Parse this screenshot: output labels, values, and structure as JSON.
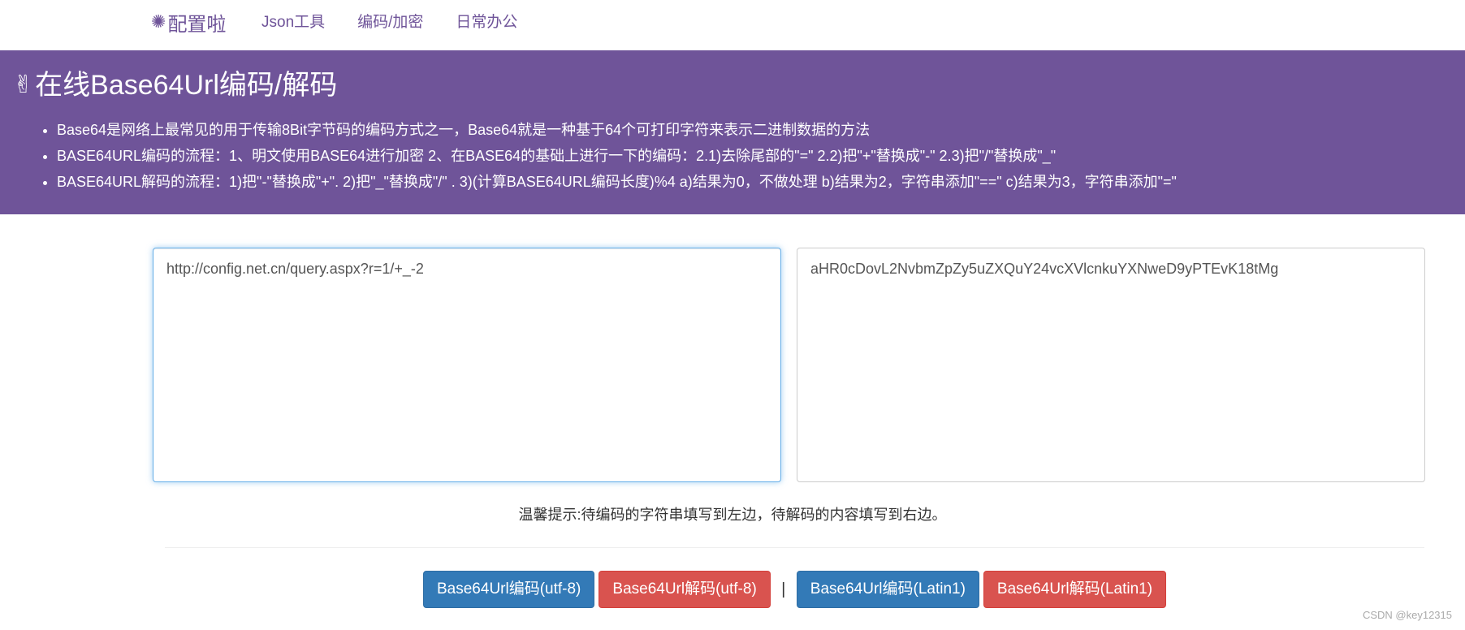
{
  "nav": {
    "brand": "配置啦",
    "brand_icon": "flower-icon",
    "links": [
      "Json工具",
      "编码/加密",
      "日常办公"
    ]
  },
  "hero": {
    "title": "在线Base64Url编码/解码",
    "title_icon": "victory-hand-icon",
    "bullets": [
      "Base64是网络上最常见的用于传输8Bit字节码的编码方式之一，Base64就是一种基于64个可打印字符来表示二进制数据的方法",
      "BASE64URL编码的流程：1、明文使用BASE64进行加密 2、在BASE64的基础上进行一下的编码：2.1)去除尾部的\"=\" 2.2)把\"+\"替换成\"-\" 2.3)把\"/\"替换成\"_\"",
      "BASE64URL解码的流程：1)把\"-\"替换成\"+\". 2)把\"_\"替换成\"/\" . 3)(计算BASE64URL编码长度)%4 a)结果为0，不做处理 b)结果为2，字符串添加\"==\" c)结果为3，字符串添加\"=\""
    ]
  },
  "editors": {
    "input_value": "http://config.net.cn/query.aspx?r=1/+_-2",
    "output_value": "aHR0cDovL2NvbmZpZy5uZXQuY24vcXVlcnkuYXNweD9yPTEvK18tMg"
  },
  "tip": "温馨提示:待编码的字符串填写到左边，待解码的内容填写到右边。",
  "buttons": {
    "encode_utf8": "Base64Url编码(utf-8)",
    "decode_utf8": "Base64Url解码(utf-8)",
    "separator": "|",
    "encode_latin1": "Base64Url编码(Latin1)",
    "decode_latin1": "Base64Url解码(Latin1)"
  },
  "watermark": "CSDN @key12315",
  "colors": {
    "brand_purple": "#6f5499",
    "primary_blue": "#337ab7",
    "danger_red": "#d9534f"
  }
}
